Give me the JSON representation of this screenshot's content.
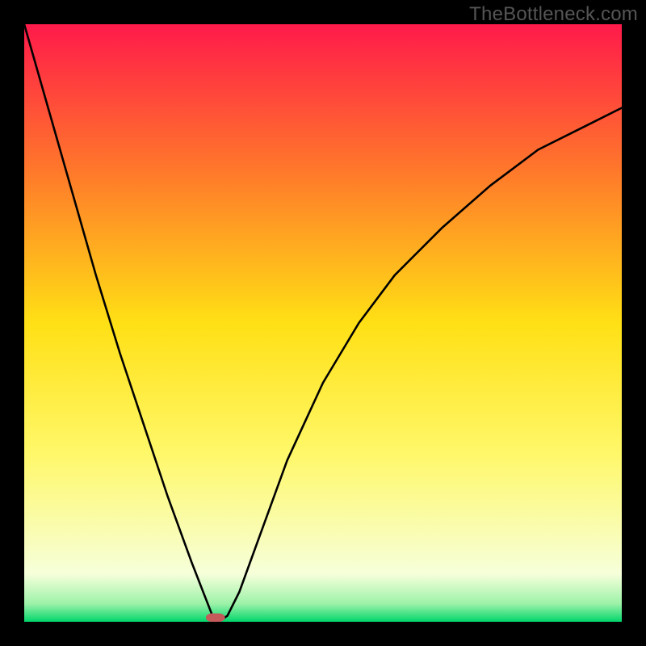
{
  "watermark": "TheBottleneck.com",
  "chart_data": {
    "type": "line",
    "xlim": [
      0,
      100
    ],
    "ylim": [
      0,
      100
    ],
    "xlabel": "",
    "ylabel": "",
    "title": "",
    "background": "rainbow-gradient",
    "gradient_stops": [
      {
        "offset": 0,
        "color": "#ff1a4a"
      },
      {
        "offset": 25,
        "color": "#ff7a2a"
      },
      {
        "offset": 50,
        "color": "#ffe015"
      },
      {
        "offset": 72,
        "color": "#fff86a"
      },
      {
        "offset": 92,
        "color": "#f6ffda"
      },
      {
        "offset": 97,
        "color": "#9cf2a8"
      },
      {
        "offset": 100,
        "color": "#00d66b"
      }
    ],
    "x": [
      0,
      4,
      8,
      12,
      16,
      20,
      24,
      28,
      31.5,
      32.5,
      34,
      36,
      40,
      44,
      50,
      56,
      62,
      70,
      78,
      86,
      94,
      100
    ],
    "values": [
      100,
      86,
      72,
      58,
      45,
      33,
      21,
      10,
      1,
      0,
      1,
      5,
      16,
      27,
      40,
      50,
      58,
      66,
      73,
      79,
      83,
      86
    ],
    "marker": {
      "x": 32,
      "y": 0,
      "w": 3.2,
      "h": 1.4,
      "rx": 1.0,
      "color": "#c45a5a"
    }
  }
}
